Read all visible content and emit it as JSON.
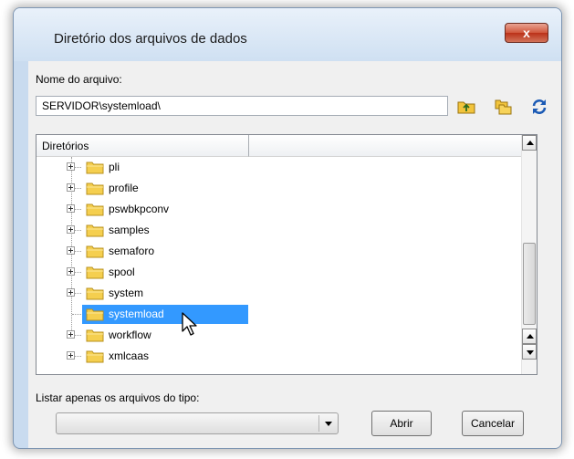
{
  "window": {
    "title": "Diretório dos arquivos de dados",
    "close_glyph": "x"
  },
  "filename": {
    "label": "Nome do arquivo:",
    "value": "SERVIDOR\\systemload\\"
  },
  "toolbar": {
    "icons": [
      "folder-up-icon",
      "folders-icon",
      "refresh-icon"
    ],
    "colors": {
      "folder": "#f2c43c",
      "refresh": "#1c5bb5"
    }
  },
  "tree": {
    "header": "Diretórios",
    "items": [
      {
        "label": "pli",
        "expandable": true
      },
      {
        "label": "profile",
        "expandable": true
      },
      {
        "label": "pswbkpconv",
        "expandable": true
      },
      {
        "label": "samples",
        "expandable": true
      },
      {
        "label": "semaforo",
        "expandable": true
      },
      {
        "label": "spool",
        "expandable": true
      },
      {
        "label": "system",
        "expandable": true
      },
      {
        "label": "systemload",
        "expandable": false,
        "selected": true
      },
      {
        "label": "workflow",
        "expandable": true
      },
      {
        "label": "xmlcaas",
        "expandable": true
      }
    ],
    "selection_color": "#3399ff"
  },
  "filter": {
    "label": "Listar apenas os arquivos do tipo:",
    "value": ""
  },
  "buttons": {
    "open": "Abrir",
    "cancel": "Cancelar"
  }
}
